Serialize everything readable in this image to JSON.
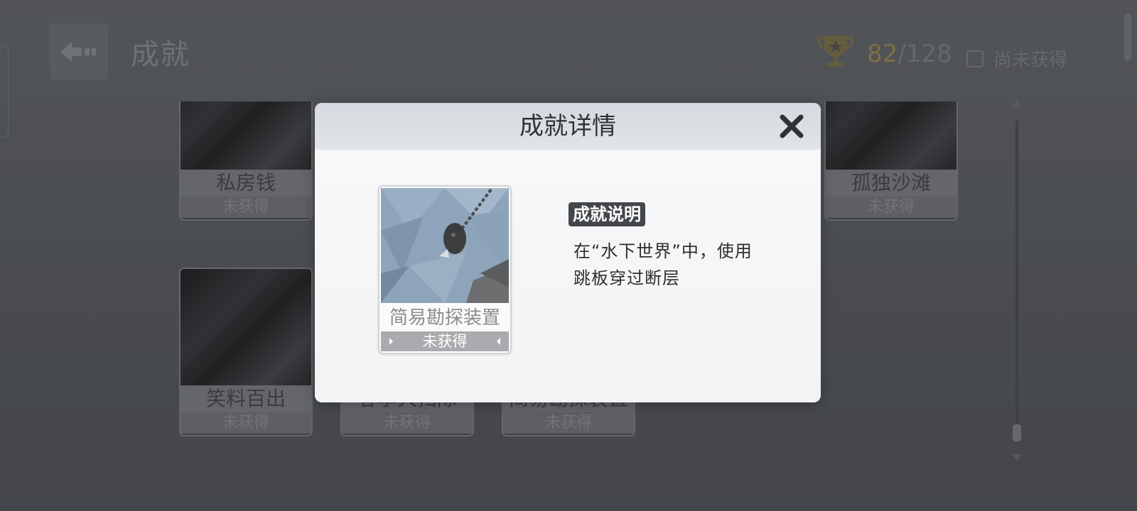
{
  "header": {
    "title": "成就",
    "score_got": "82",
    "score_total": "/128",
    "filter_label": "尚未获得"
  },
  "background_cards": [
    {
      "name": "私房钱",
      "status": "未获得"
    },
    {
      "name": "孤独沙滩",
      "status": "未获得"
    },
    {
      "name": "笑料百出",
      "status": "未获得"
    },
    {
      "name": "春季大扫除",
      "status": "未获得"
    },
    {
      "name": "简易勘探装置",
      "status": "未获得"
    }
  ],
  "modal": {
    "title": "成就详情",
    "achievement": {
      "name": "简易勘探装置",
      "status": "未获得"
    },
    "desc_heading": "成就说明",
    "desc_line1": "在“水下世界”中，使用",
    "desc_line2": "跳板穿过断层"
  },
  "colors": {
    "score_accent": "#8a7a45",
    "modal_header": "#d8dce1",
    "badge_bg": "#43464a"
  }
}
